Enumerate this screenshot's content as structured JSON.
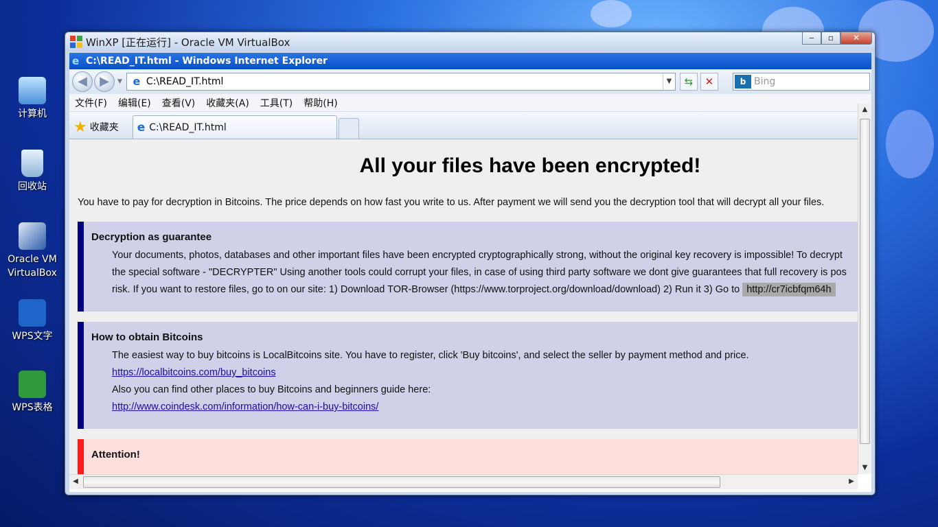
{
  "desktop": {
    "icons": [
      {
        "label": "计算机",
        "icon": "computer-icon"
      },
      {
        "label": "回收站",
        "icon": "recycle-bin-icon"
      },
      {
        "label": "Oracle VM\nVirtualBox",
        "icon": "virtualbox-icon"
      },
      {
        "label": "WPS文字",
        "icon": "wps-writer-icon"
      },
      {
        "label": "WPS表格",
        "icon": "wps-spreadsheet-icon"
      }
    ]
  },
  "vbox": {
    "title": "WinXP [正在运行] - Oracle VM VirtualBox",
    "buttons": {
      "minimize": "‒",
      "restore": "▫",
      "close": "✕"
    }
  },
  "ie": {
    "title": "C:\\READ_IT.html - Windows Internet Explorer",
    "address": "C:\\READ_IT.html",
    "search_placeholder": "Bing",
    "menu": [
      "文件(F)",
      "编辑(E)",
      "查看(V)",
      "收藏夹(A)",
      "工具(T)",
      "帮助(H)"
    ],
    "favorites_label": "收藏夹",
    "tab_label": "C:\\READ_IT.html"
  },
  "page": {
    "heading": "All your files have been encrypted!",
    "intro": "You have to pay for decryption in Bitcoins. The price depends on how fast you write to us. After payment we will send you the decryption tool that will decrypt all your files.",
    "guarantee": {
      "title": "Decryption as guarantee",
      "line1": "Your documents, photos, databases and other important files have been encrypted cryptographically strong, without the original key recovery is impossible! To decrypt",
      "line2": "the special software - \"DECRYPTER\" Using another tools could corrupt your files, in case of using third party software we dont give guarantees that full recovery is pos",
      "line3": "risk. If you want to restore files, go to on our site: 1) Download TOR-Browser (https://www.torproject.org/download/download) 2) Run it 3) Go to",
      "onion": "http://cr7icbfqm64h"
    },
    "bitcoins": {
      "title": "How to obtain Bitcoins",
      "line1": "The easiest way to buy bitcoins is LocalBitcoins site. You have to register, click 'Buy bitcoins', and select the seller by payment method and price.",
      "link1": "https://localbitcoins.com/buy_bitcoins",
      "line2": "Also you can find other places to buy Bitcoins and beginners guide here:",
      "link2": "http://www.coindesk.com/information/how-can-i-buy-bitcoins/"
    },
    "attention": {
      "title": "Attention!"
    }
  }
}
